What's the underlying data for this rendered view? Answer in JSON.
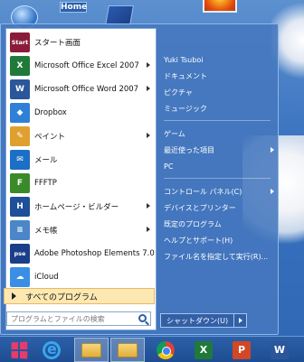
{
  "desktop": {
    "home_label": "Home"
  },
  "start_menu": {
    "programs": [
      {
        "label": "スタート画面",
        "icon": "start-screen-icon",
        "color": "#8a1c3a",
        "badge": "Start",
        "has_arrow": false
      },
      {
        "label": "Microsoft Office Excel 2007",
        "icon": "excel-icon",
        "color": "#1f7a3a",
        "badge": "X",
        "has_arrow": true
      },
      {
        "label": "Microsoft Office Word 2007",
        "icon": "word-icon",
        "color": "#2b579a",
        "badge": "W",
        "has_arrow": true
      },
      {
        "label": "Dropbox",
        "icon": "dropbox-icon",
        "color": "#2f7fd6",
        "badge": "◆",
        "has_arrow": false
      },
      {
        "label": "ペイント",
        "icon": "paint-icon",
        "color": "#e0a030",
        "badge": "✎",
        "has_arrow": true
      },
      {
        "label": "メール",
        "icon": "mail-icon",
        "color": "#1b6fc4",
        "badge": "✉",
        "has_arrow": false
      },
      {
        "label": "FFFTP",
        "icon": "ffftp-icon",
        "color": "#3a8a2a",
        "badge": "F",
        "has_arrow": false
      },
      {
        "label": "ホームページ・ビルダー",
        "icon": "homepage-builder-icon",
        "color": "#1d4f9a",
        "badge": "H",
        "has_arrow": true
      },
      {
        "label": "メモ帳",
        "icon": "notepad-icon",
        "color": "#4a86c8",
        "badge": "≡",
        "has_arrow": true
      },
      {
        "label": "Adobe Photoshop Elements 7.0",
        "icon": "photoshop-elements-icon",
        "color": "#1a3f8a",
        "badge": "pse",
        "has_arrow": false
      },
      {
        "label": "iCloud",
        "icon": "icloud-icon",
        "color": "#3a8ee6",
        "badge": "☁",
        "has_arrow": false
      }
    ],
    "all_programs_label": "すべてのプログラム",
    "search_placeholder": "プログラムとファイルの検索",
    "right_items": [
      {
        "label": "Yuki Tsuboi",
        "has_arrow": false
      },
      {
        "label": "ドキュメント",
        "has_arrow": false
      },
      {
        "label": "ピクチャ",
        "has_arrow": false
      },
      {
        "label": "ミュージック",
        "has_arrow": false
      },
      {
        "label": "ゲーム",
        "has_arrow": false
      },
      {
        "label": "最近使った項目",
        "has_arrow": true
      },
      {
        "label": "PC",
        "has_arrow": false
      },
      {
        "label": "コントロール パネル(C)",
        "has_arrow": true
      },
      {
        "label": "デバイスとプリンター",
        "has_arrow": false
      },
      {
        "label": "既定のプログラム",
        "has_arrow": false
      },
      {
        "label": "ヘルプとサポート(H)",
        "has_arrow": false
      },
      {
        "label": "ファイル名を指定して実行(R)...",
        "has_arrow": false
      }
    ],
    "shutdown_label": "シャットダウン(U)"
  },
  "taskbar": {
    "items": [
      {
        "name": "start-button",
        "icon": "windows-logo-icon",
        "active": false
      },
      {
        "name": "internet-explorer-button",
        "icon": "internet-explorer-icon",
        "active": false
      },
      {
        "name": "explorer-button",
        "icon": "folder-icon",
        "active": true
      },
      {
        "name": "explorer-button-2",
        "icon": "folder-icon",
        "active": true
      },
      {
        "name": "chrome-button",
        "icon": "chrome-icon",
        "active": false
      },
      {
        "name": "excel-button",
        "icon": "excel-icon",
        "badge": "X",
        "color": "#1f7a3a",
        "active": false
      },
      {
        "name": "powerpoint-button",
        "icon": "powerpoint-icon",
        "badge": "P",
        "color": "#d24726",
        "active": false
      },
      {
        "name": "word-button",
        "icon": "word-icon",
        "badge": "W",
        "color": "#2b579a",
        "active": false
      }
    ]
  }
}
